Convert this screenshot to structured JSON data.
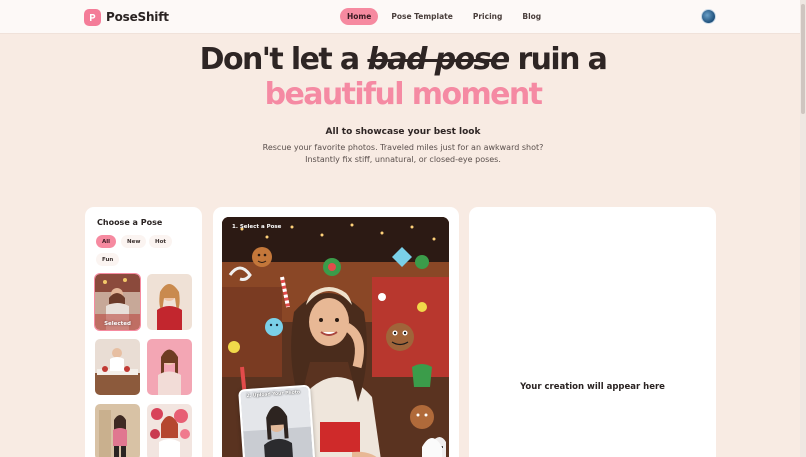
{
  "brand": {
    "name": "PoseShift",
    "accent": "#f68aa0"
  },
  "nav": {
    "links": [
      {
        "label": "Home",
        "active": true
      },
      {
        "label": "Pose Template",
        "active": false
      },
      {
        "label": "Pricing",
        "active": false
      },
      {
        "label": "Blog",
        "active": false
      }
    ]
  },
  "hero": {
    "line1_start": "Don't let a",
    "line1_strike": "bad pose",
    "line1_end": "ruin a",
    "line2": "beautiful moment",
    "subtitle": "All to showcase your best look",
    "desc1": "Rescue your favorite photos. Traveled miles just for an awkward shot?",
    "desc2": "Instantly fix stiff, unnatural, or closed-eye poses."
  },
  "pose_panel": {
    "title": "Choose a Pose",
    "filters": [
      "All",
      "New",
      "Hot",
      "Fun"
    ],
    "active_filter": "All",
    "selected_label": "Selected"
  },
  "editor": {
    "step1": "1. Select a Pose",
    "step2": "2. Upload Your Photo"
  },
  "result": {
    "placeholder": "Your creation will appear here"
  }
}
